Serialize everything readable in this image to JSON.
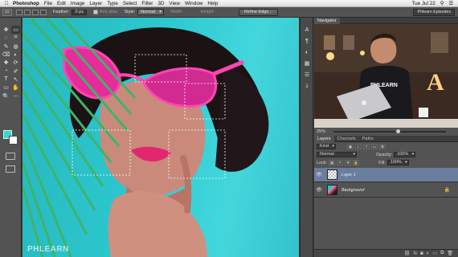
{
  "menubar": {
    "app_name": "Photoshop",
    "items": [
      "File",
      "Edit",
      "Image",
      "Layer",
      "Type",
      "Select",
      "Filter",
      "3D",
      "View",
      "Window",
      "Help"
    ],
    "datetime": "Tue Jul 22",
    "icons": [
      "apple-icon",
      "search-icon",
      "list-icon"
    ]
  },
  "options_bar": {
    "feather_label": "Feather:",
    "feather_value": "0 px",
    "antialias_label": "Anti-alias",
    "style_label": "Style:",
    "style_value": "Normal",
    "width_label": "Width:",
    "height_label": "Height:",
    "refine_button": "Refine Edge...",
    "workspace": "Phlearn Episodes"
  },
  "toolbox": {
    "tools": [
      "✥",
      "▭",
      "◌",
      "⌗",
      "✎",
      "◍",
      "⌫",
      "◐",
      "✚",
      "⟳",
      "◔",
      "✐",
      "T",
      "↖",
      "▭",
      "✋",
      "🔍",
      "⋯"
    ],
    "foreground_color": "#35d7d2",
    "background_color": "#ffffff"
  },
  "canvas": {
    "watermark": "PHLEARN"
  },
  "navigator": {
    "title": "Navigator",
    "zoom": "25%",
    "shirt_text": "PHLEARN"
  },
  "layers_panel": {
    "tabs": [
      "Layers",
      "Channels",
      "Paths"
    ],
    "filter_kind": "Kind",
    "blend_mode": "Normal",
    "opacity_label": "Opacity:",
    "opacity_value": "100%",
    "lock_label": "Lock:",
    "fill_label": "Fill:",
    "fill_value": "100%",
    "layers": [
      {
        "name": "Layer 1",
        "selected": true,
        "thumbnail": "transparent"
      },
      {
        "name": "Background",
        "selected": false,
        "thumbnail": "photo",
        "locked": true
      }
    ],
    "footer_icons": [
      "link-icon",
      "fx-icon",
      "mask-icon",
      "adjustment-icon",
      "folder-icon",
      "new-layer-icon",
      "trash-icon"
    ]
  }
}
